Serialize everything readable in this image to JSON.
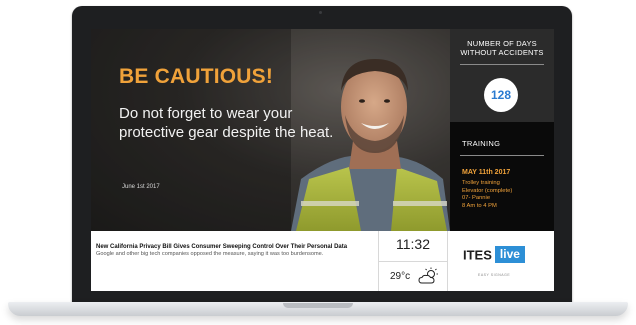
{
  "hero": {
    "headline": "BE CAUTIOUS!",
    "message": "Do not forget to wear your protective gear despite the heat.",
    "date": "June 1st 2017"
  },
  "accidents": {
    "title": "NUMBER OF DAYS WITHOUT ACCIDENTS",
    "count": "128"
  },
  "training": {
    "title": "TRAINING",
    "date": "MAY 11th 2017",
    "details": [
      "Trolley training",
      "Elevator (complete)",
      "07- Pannie",
      "8 Am to 4 PM"
    ]
  },
  "news": {
    "title": "New California Privacy Bill Gives Consumer Sweeping Control Over Their Personal Data",
    "body": "Google and other big tech companies opposed the measure, saying it was too burdensome."
  },
  "clock": {
    "time": "11:32"
  },
  "weather": {
    "temperature": "29°c",
    "icon": "partly-cloudy-icon"
  },
  "brand": {
    "name": "ITES",
    "badge": "live",
    "tagline": "EASY SIGNAGE"
  },
  "colors": {
    "accent_orange": "#f0a23a",
    "accent_blue": "#2d8fd6",
    "panel_dark": "#2b2b2b",
    "panel_black": "#0a0a0a"
  }
}
